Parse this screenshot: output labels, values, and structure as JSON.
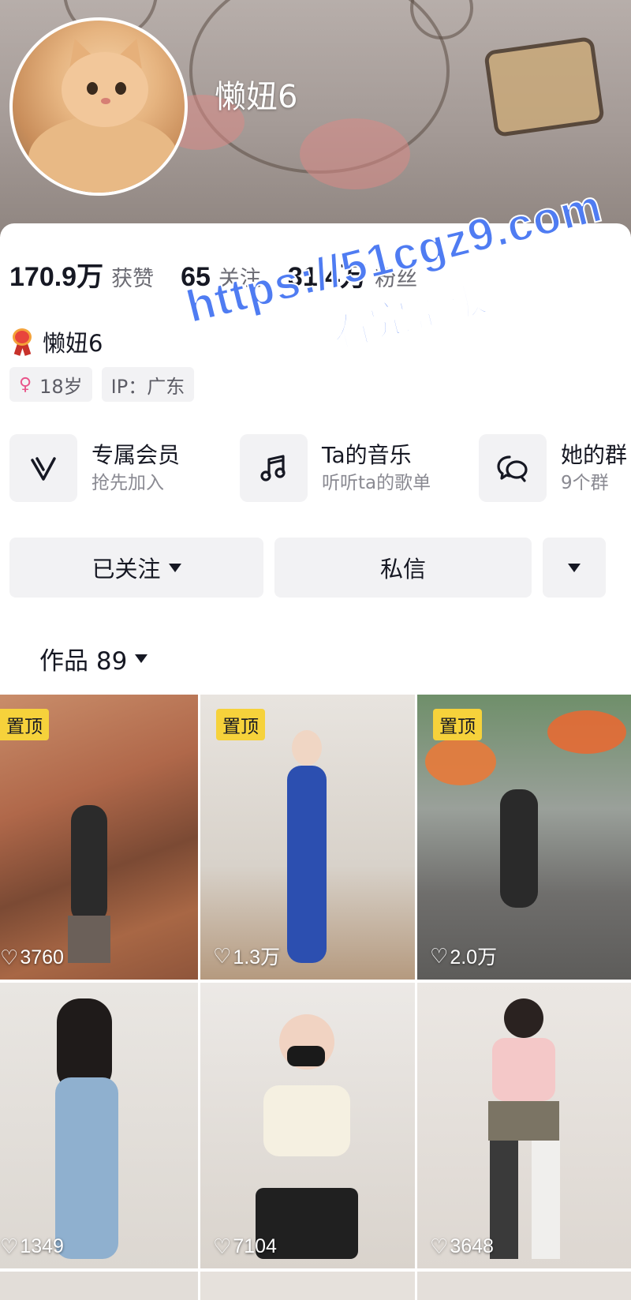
{
  "profile": {
    "name": "懒妞6",
    "stats": [
      {
        "value": "170.9万",
        "label": "获赞"
      },
      {
        "value": "65",
        "label": "关注"
      },
      {
        "value": "31.4万",
        "label": "粉丝"
      }
    ],
    "display_name": "懒妞6",
    "tags": {
      "age": "18岁",
      "ip": "IP：广东"
    }
  },
  "features": [
    {
      "icon": "vip-v-icon",
      "title": "专属会员",
      "subtitle": "抢先加入"
    },
    {
      "icon": "music-note-icon",
      "title": "Ta的音乐",
      "subtitle": "听听ta的歌单"
    },
    {
      "icon": "chat-bubbles-icon",
      "title": "她的群",
      "subtitle": "9个群"
    }
  ],
  "actions": {
    "follow_label": "已关注",
    "message_label": "私信"
  },
  "works": {
    "label": "作品 89"
  },
  "videos": [
    {
      "pinned": "置顶",
      "likes": "3760"
    },
    {
      "pinned": "置顶",
      "likes": "1.3万"
    },
    {
      "pinned": "置顶",
      "likes": "2.0万"
    },
    {
      "pinned": "",
      "likes": "1349"
    },
    {
      "pinned": "",
      "likes": "7104"
    },
    {
      "pinned": "",
      "likes": "3648"
    }
  ],
  "watermark": {
    "line1": "https://51cgz9.com",
    "line2": "看完整版"
  },
  "colors": {
    "pin_badge": "#f6d23b",
    "watermark": "#4f7cf2",
    "female_icon": "#e9548a"
  }
}
